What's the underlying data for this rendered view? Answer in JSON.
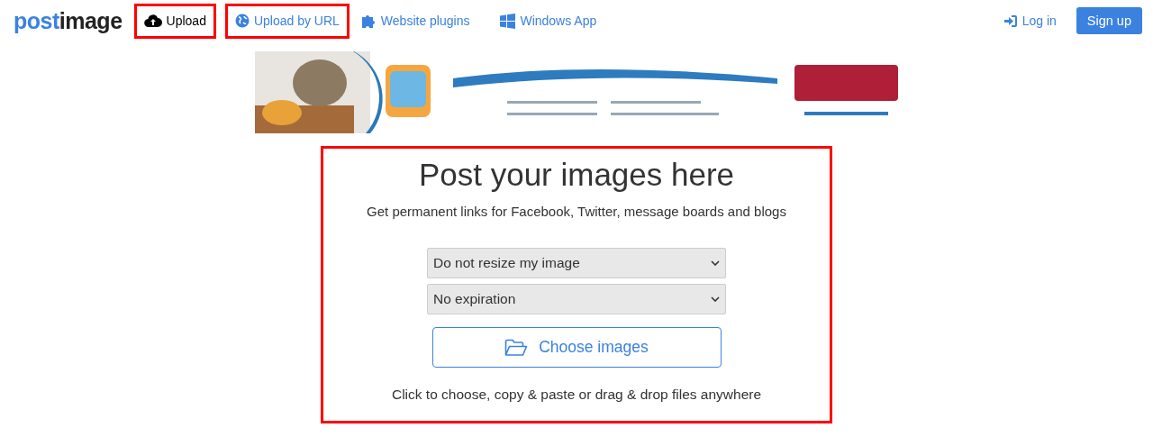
{
  "logo": {
    "first": "post",
    "second": "image"
  },
  "nav": [
    {
      "label": "Upload",
      "kind": "upload",
      "selected": true,
      "highlighted": true
    },
    {
      "label": "Upload by URL",
      "kind": "url",
      "selected": false,
      "highlighted": true
    },
    {
      "label": "Website plugins",
      "kind": "plugins",
      "selected": false,
      "highlighted": false
    },
    {
      "label": "Windows App",
      "kind": "app",
      "selected": false,
      "highlighted": false
    }
  ],
  "account": {
    "login": "Log in",
    "signup": "Sign up"
  },
  "upload_panel": {
    "highlighted": true,
    "title": "Post your images here",
    "subtitle": "Get permanent links for Facebook, Twitter, message boards and blogs",
    "selects": [
      {
        "value": "Do not resize my image"
      },
      {
        "value": "No expiration"
      }
    ],
    "choose_button": "Choose images",
    "hint": "Click to choose, copy & paste or drag & drop files anywhere"
  }
}
